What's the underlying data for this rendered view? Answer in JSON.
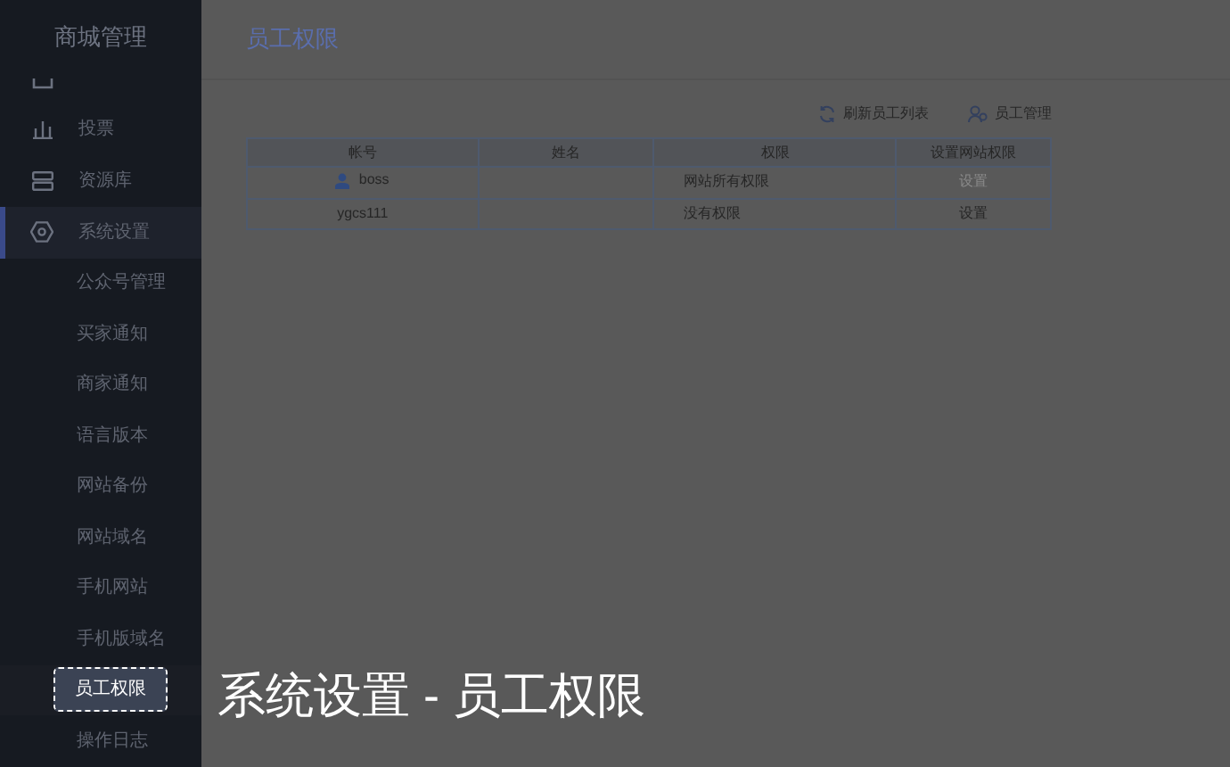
{
  "sidebar": {
    "title": "商城管理",
    "items": [
      {
        "selected": false
      },
      {
        "label": "投票",
        "selected": false
      },
      {
        "label": "资源库",
        "selected": false
      },
      {
        "label": "系统设置",
        "selected": true,
        "expanded": true,
        "children": [
          {
            "label": "公众号管理",
            "selected": false
          },
          {
            "label": "买家通知",
            "selected": false
          },
          {
            "label": "商家通知",
            "selected": false
          },
          {
            "label": "语言版本",
            "selected": false
          },
          {
            "label": "网站备份",
            "selected": false
          },
          {
            "label": "网站域名",
            "selected": false
          },
          {
            "label": "手机网站",
            "selected": false
          },
          {
            "label": "手机版域名",
            "selected": false
          },
          {
            "label": "员工权限",
            "selected": true
          },
          {
            "label": "操作日志",
            "selected": false
          }
        ]
      }
    ]
  },
  "page": {
    "title": "员工权限"
  },
  "toolbar": [
    {
      "label": "刷新员工列表"
    },
    {
      "label": "员工管理"
    }
  ],
  "table": {
    "columns": [
      "帐号",
      "姓名",
      "权限",
      "设置网站权限"
    ],
    "rows": [
      {
        "account": "boss",
        "owner": true,
        "permission": "网站所有权限",
        "action": "设置",
        "disabled": true
      },
      {
        "account": "ygcs111",
        "owner": false,
        "permission": "没有权限",
        "action": "设置",
        "disabled": false
      }
    ]
  },
  "caption": "系统设置 - 员工权限"
}
